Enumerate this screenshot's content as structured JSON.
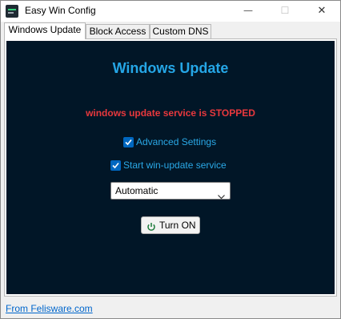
{
  "window": {
    "title": "Easy Win Config",
    "controls": {
      "minimize": "—",
      "maximize": "☐",
      "close": "✕"
    }
  },
  "tabs": [
    {
      "label": "Windows Update",
      "active": true
    },
    {
      "label": "Block Access",
      "active": false
    },
    {
      "label": "Custom DNS",
      "active": false
    }
  ],
  "panel": {
    "heading": "Windows Update",
    "status": "windows update service is STOPPED",
    "advanced_settings": {
      "label": "Advanced Settings",
      "checked": true
    },
    "start_service": {
      "label": "Start win-update service",
      "checked": true
    },
    "startup_type": {
      "selected": "Automatic"
    },
    "toggle_button": {
      "label": "Turn ON",
      "icon": "power-icon"
    }
  },
  "footer": {
    "link_text": "From Felisware.com"
  },
  "colors": {
    "panel_bg": "#011627",
    "heading": "#25a6e6",
    "status": "#e8383d",
    "accent": "#0067c0"
  }
}
